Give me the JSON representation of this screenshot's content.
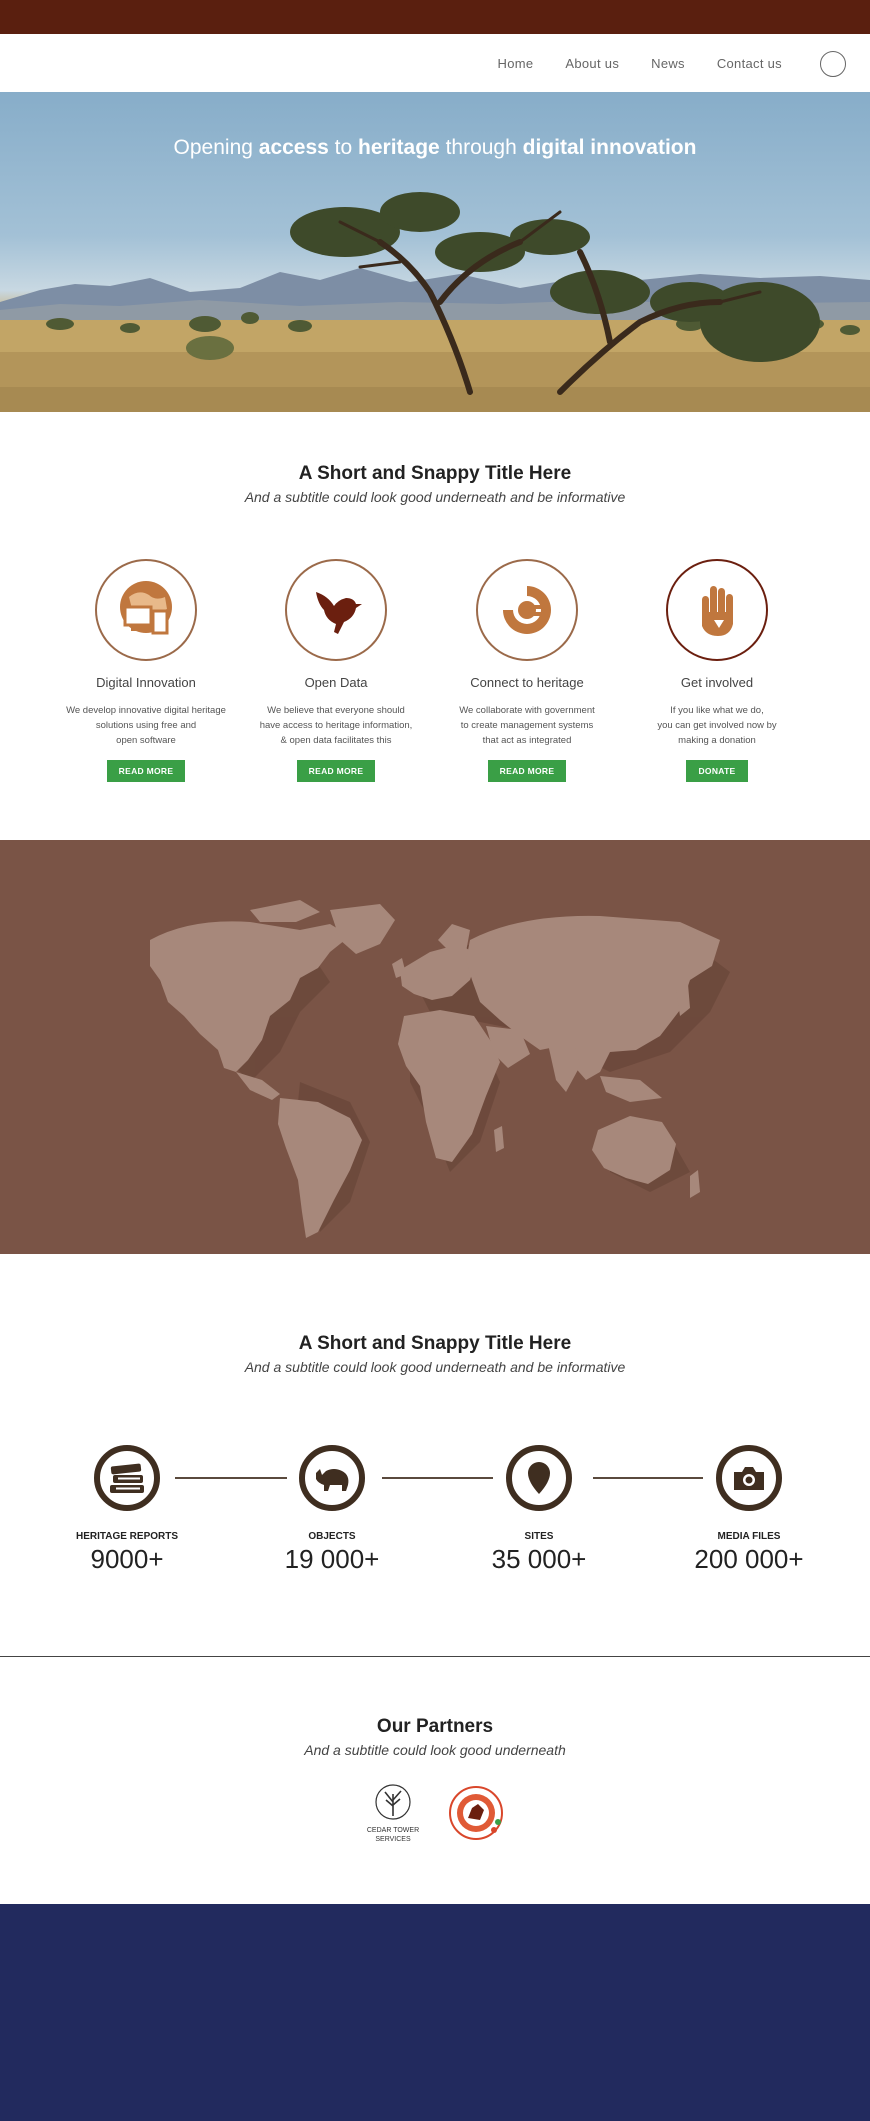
{
  "nav": {
    "links": [
      "Home",
      "About us",
      "News",
      "Contact us"
    ],
    "search_icon": "circle-icon"
  },
  "hero": {
    "title_parts": [
      "Opening ",
      "access",
      " to ",
      "heritage",
      " through ",
      "digital innovation"
    ]
  },
  "intro": {
    "title": "A Short and Snappy Title Here",
    "subtitle": "And a subtitle could look good underneath and be informative"
  },
  "features": [
    {
      "title": "Digital Innovation",
      "desc": "We develop innovative digital heritage\nsolutions using free and\nopen software",
      "button": "READ MORE",
      "icon": "devices-globe-icon"
    },
    {
      "title": "Open Data",
      "desc": "We believe that everyone should\nhave access to heritage information,\n& open data facilitates this",
      "button": "READ MORE",
      "icon": "bird-icon"
    },
    {
      "title": "Connect to heritage",
      "desc": "We collaborate with government\nto create management systems\nthat act as integrated",
      "button": "READ MORE",
      "icon": "plug-icon"
    },
    {
      "title": "Get involved",
      "desc": "If you like what we do,\nyou can get involved now by\nmaking a donation",
      "button": "DONATE",
      "icon": "hand-icon"
    }
  ],
  "stats_section": {
    "title": "A Short and Snappy Title Here",
    "subtitle": "And a subtitle could look good underneath and be informative",
    "stats": [
      {
        "label": "HERITAGE REPORTS",
        "value": "9000+",
        "icon": "books-icon"
      },
      {
        "label": "OBJECTS",
        "value": "19 000+",
        "icon": "rhino-icon"
      },
      {
        "label": "SITES",
        "value": "35 000+",
        "icon": "map-pin-icon"
      },
      {
        "label": "MEDIA FILES",
        "value": "200 000+",
        "icon": "camera-icon"
      }
    ]
  },
  "partners": {
    "title": "Our Partners",
    "subtitle": "And a subtitle could look good underneath",
    "logos": [
      "cedar-tower-services-logo",
      "circular-emblem-logo"
    ]
  },
  "colors": {
    "topbar": "#5a1f0f",
    "map_bg": "#7a5446",
    "button": "#3a9f46",
    "footer": "#222a5e",
    "icon_orange": "#c0773e"
  }
}
